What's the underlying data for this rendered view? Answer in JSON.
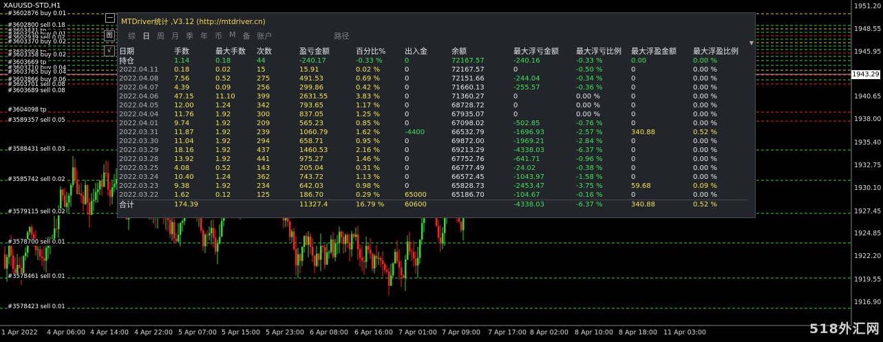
{
  "symbol": "XAUUSD-STD,H1",
  "panel": {
    "title": "MTDriver统计 ,V3.12 (http://mtdriver.cn)",
    "tabs": [
      "综",
      "日",
      "周",
      "月",
      "季",
      "年",
      "币",
      "M",
      "备",
      "账户",
      "路径"
    ],
    "active_tab": "日",
    "headers": [
      "日期",
      "手数",
      "最大手数",
      "次数",
      "盈亏金额",
      "百分比%",
      "出入金",
      "余额",
      "最大浮亏金额",
      "最大浮亏比例",
      "最大浮盈金额",
      "最大浮盈比例"
    ],
    "holding": [
      "持仓",
      "1.14",
      "0.18",
      "44",
      "-240.17",
      "-0.33 %",
      "0",
      "72167.57",
      "-240.16",
      "-0.33 %",
      "0.00",
      "0.00 %"
    ],
    "rows": [
      [
        "2022.04.11",
        "0.18",
        "0.02",
        "15",
        "15.91",
        "0.02 %",
        "0",
        "72167.57",
        "0",
        "-0.50 %",
        "0",
        "0.00 %"
      ],
      [
        "2022.04.08",
        "7.56",
        "0.52",
        "275",
        "491.53",
        "0.69 %",
        "0",
        "72151.66",
        "-244.04",
        "-0.34 %",
        "0",
        "0.00 %"
      ],
      [
        "2022.04.07",
        "4.39",
        "0.09",
        "256",
        "299.86",
        "0.42 %",
        "0",
        "71660.13",
        "-255.57",
        "-0.36 %",
        "0",
        "0.00 %"
      ],
      [
        "2022.04.06",
        "47.15",
        "11.10",
        "399",
        "2631.55",
        "3.83 %",
        "0",
        "71360.27",
        "0",
        "0.00 %",
        "0",
        "0.00 %"
      ],
      [
        "2022.04.05",
        "12.00",
        "1.24",
        "342",
        "793.65",
        "1.17 %",
        "0",
        "68728.72",
        "0",
        "0.00 %",
        "0",
        "0.00 %"
      ],
      [
        "2022.04.04",
        "11.76",
        "1.92",
        "300",
        "837.05",
        "1.25 %",
        "0",
        "67935.07",
        "0",
        "0.00 %",
        "0",
        "0.00 %"
      ],
      [
        "2022.04.01",
        "9.74",
        "1.92",
        "209",
        "565.23",
        "0.85 %",
        "0",
        "67098.02",
        "-502.85",
        "-0.76 %",
        "0",
        "0.00 %"
      ],
      [
        "2022.03.31",
        "11.87",
        "1.92",
        "239",
        "1060.79",
        "1.62 %",
        "-4400",
        "66532.79",
        "-1696.93",
        "-2.57 %",
        "340.88",
        "0.52 %"
      ],
      [
        "2022.03.30",
        "11.04",
        "1.92",
        "294",
        "658.71",
        "0.95 %",
        "0",
        "69872.00",
        "-1969.21",
        "-2.84 %",
        "0",
        "0.00 %"
      ],
      [
        "2022.03.29",
        "18.16",
        "1.92",
        "437",
        "1460.53",
        "2.16 %",
        "0",
        "69213.29",
        "-4338.03",
        "-6.37 %",
        "0",
        "0.00 %"
      ],
      [
        "2022.03.28",
        "13.92",
        "1.92",
        "441",
        "975.27",
        "1.46 %",
        "0",
        "67752.76",
        "-641.71",
        "-0.96 %",
        "0",
        "0.00 %"
      ],
      [
        "2022.03.25",
        "4.08",
        "0.52",
        "143",
        "205.04",
        "0.31 %",
        "0",
        "66777.49",
        "-24.02",
        "-0.38 %",
        "0",
        "0.00 %"
      ],
      [
        "2022.03.24",
        "10.40",
        "1.24",
        "362",
        "743.72",
        "1.13 %",
        "0",
        "66572.45",
        "-1043.97",
        "-1.58 %",
        "0",
        "0.00 %"
      ],
      [
        "2022.03.23",
        "9.38",
        "1.92",
        "234",
        "642.03",
        "0.98 %",
        "0",
        "65828.73",
        "-2453.47",
        "-3.75 %",
        "59.68",
        "0.09 %"
      ],
      [
        "2022.03.22",
        "1.62",
        "0.12",
        "125",
        "186.70",
        "0.29 %",
        "65000",
        "65186.70",
        "-104.67",
        "-0.16 %",
        "0",
        "0.00 %"
      ]
    ],
    "total": [
      "合计",
      "174.39",
      "",
      "",
      "11327.4",
      "16.79 %",
      "60600",
      "",
      "-4338.03",
      "-6.37 %",
      "340.88",
      "0.52 %"
    ]
  },
  "order_labels": [
    {
      "text": "#3602876 buy 0.01"
    },
    {
      "text": "#3602800 sell 0.18"
    },
    {
      "text": "#3603431 tp"
    },
    {
      "text": "#3603250 buy 0.01"
    },
    {
      "text": "#3602939 sell 0.02"
    },
    {
      "text": "#3603370 buy 0.02"
    },
    {
      "text": "#3603003 tp"
    },
    {
      "text": "#3603358 buy 0.02"
    },
    {
      "text": "#3603669 tp"
    },
    {
      "text": "#3603710 buy 0.04"
    },
    {
      "text": "#3603765 buy 0.04"
    },
    {
      "text": "#3603866 buy 0.06"
    },
    {
      "text": "#3603701 sell 0.08"
    },
    {
      "text": "#3603689 sell 0.08"
    },
    {
      "text": "#3604098 tp"
    },
    {
      "text": "#3589357 sell 0.05"
    },
    {
      "text": "#3588431 sell 0.03"
    },
    {
      "text": "#3585742 sell 0.02"
    },
    {
      "text": "#3579115 sell 0.02"
    },
    {
      "text": "#3578700 sell 0.01"
    },
    {
      "text": "#3578461 sell 0.01"
    },
    {
      "text": "#3578423 sell 0.01"
    }
  ],
  "price_axis": [
    "1951.20",
    "1948.55",
    "1945.95",
    "1940.65",
    "1938.00",
    "1935.40",
    "1932.75",
    "1930.10",
    "1927.45",
    "1924.85",
    "1922.20",
    "1919.55",
    "1916.90"
  ],
  "current_price": "1943.29",
  "time_axis": [
    "1 Apr 2022",
    "4 Apr 06:00",
    "4 Apr 14:00",
    "4 Apr 22:00",
    "5 Apr 07:00",
    "5 Apr 15:00",
    "5 Apr 23:00",
    "6 Apr 08:00",
    "6 Apr 16:00",
    "7 Apr 01:00",
    "7 Apr 09:00",
    "7 Apr 17:00",
    "8 Apr 02:00",
    "8 Apr 10:00",
    "8 Apr 18:00",
    "11 Apr 03:00"
  ],
  "tool_button": "图",
  "check_button": "√",
  "watermark": "518外汇网",
  "colors": {
    "bull": "#2fdb2f",
    "bear": "#ff2020",
    "panel": "#22262b",
    "yellow": "#f2e34a",
    "green": "#3fe05a"
  }
}
